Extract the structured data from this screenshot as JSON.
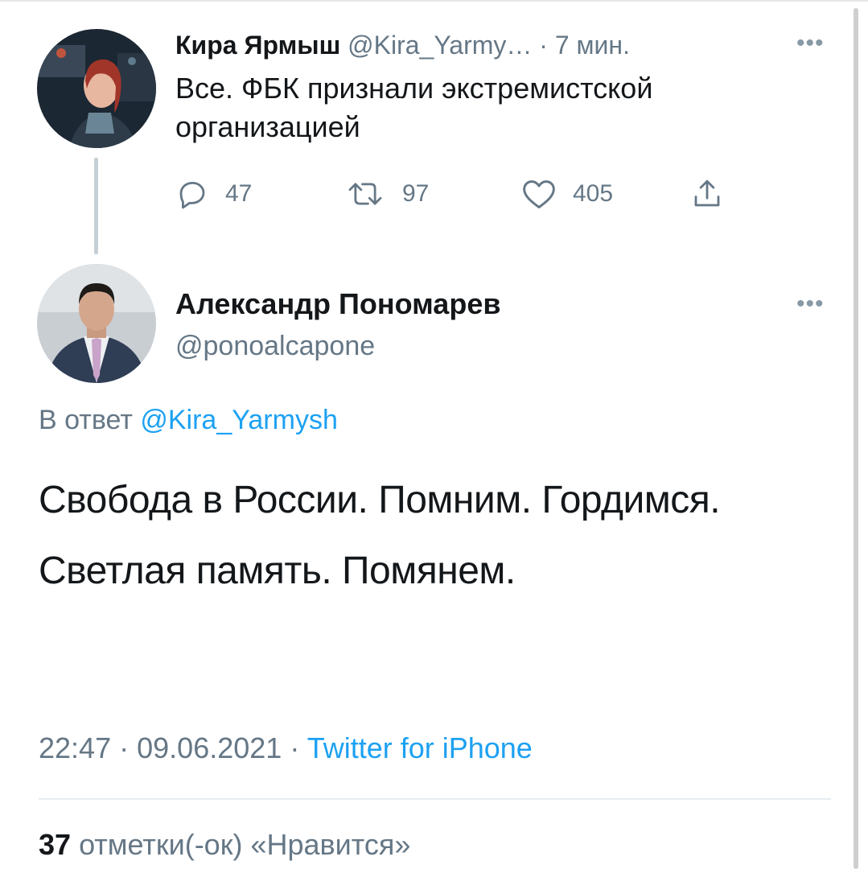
{
  "tweet1": {
    "name": "Кира Ярмыш",
    "handle": "@Kira_Yarmy…",
    "time_sep": "·",
    "time": "7 мин.",
    "text": "Все. ФБК признали экстремистской организацией",
    "actions": {
      "reply_count": "47",
      "retweet_count": "97",
      "like_count": "405"
    }
  },
  "tweet2": {
    "name": "Александр Пономарев",
    "handle": "@ponoalcapone",
    "reply_prefix": "В ответ",
    "reply_handle": "@Kira_Yarmysh",
    "text": "Свобода в России. Помним. Гордимся. Светлая память. Помянем.",
    "time": "22:47",
    "sep": "·",
    "date": "09.06.2021",
    "source": "Twitter for iPhone",
    "likes_count": "37",
    "likes_label": "отметки(-ок) «Нравится»"
  },
  "colors": {
    "link": "#1da1f2",
    "secondary_text": "#657786",
    "primary_text": "#14171a"
  },
  "icons": [
    "more-icon",
    "reply-icon",
    "retweet-icon",
    "like-icon",
    "share-icon"
  ]
}
